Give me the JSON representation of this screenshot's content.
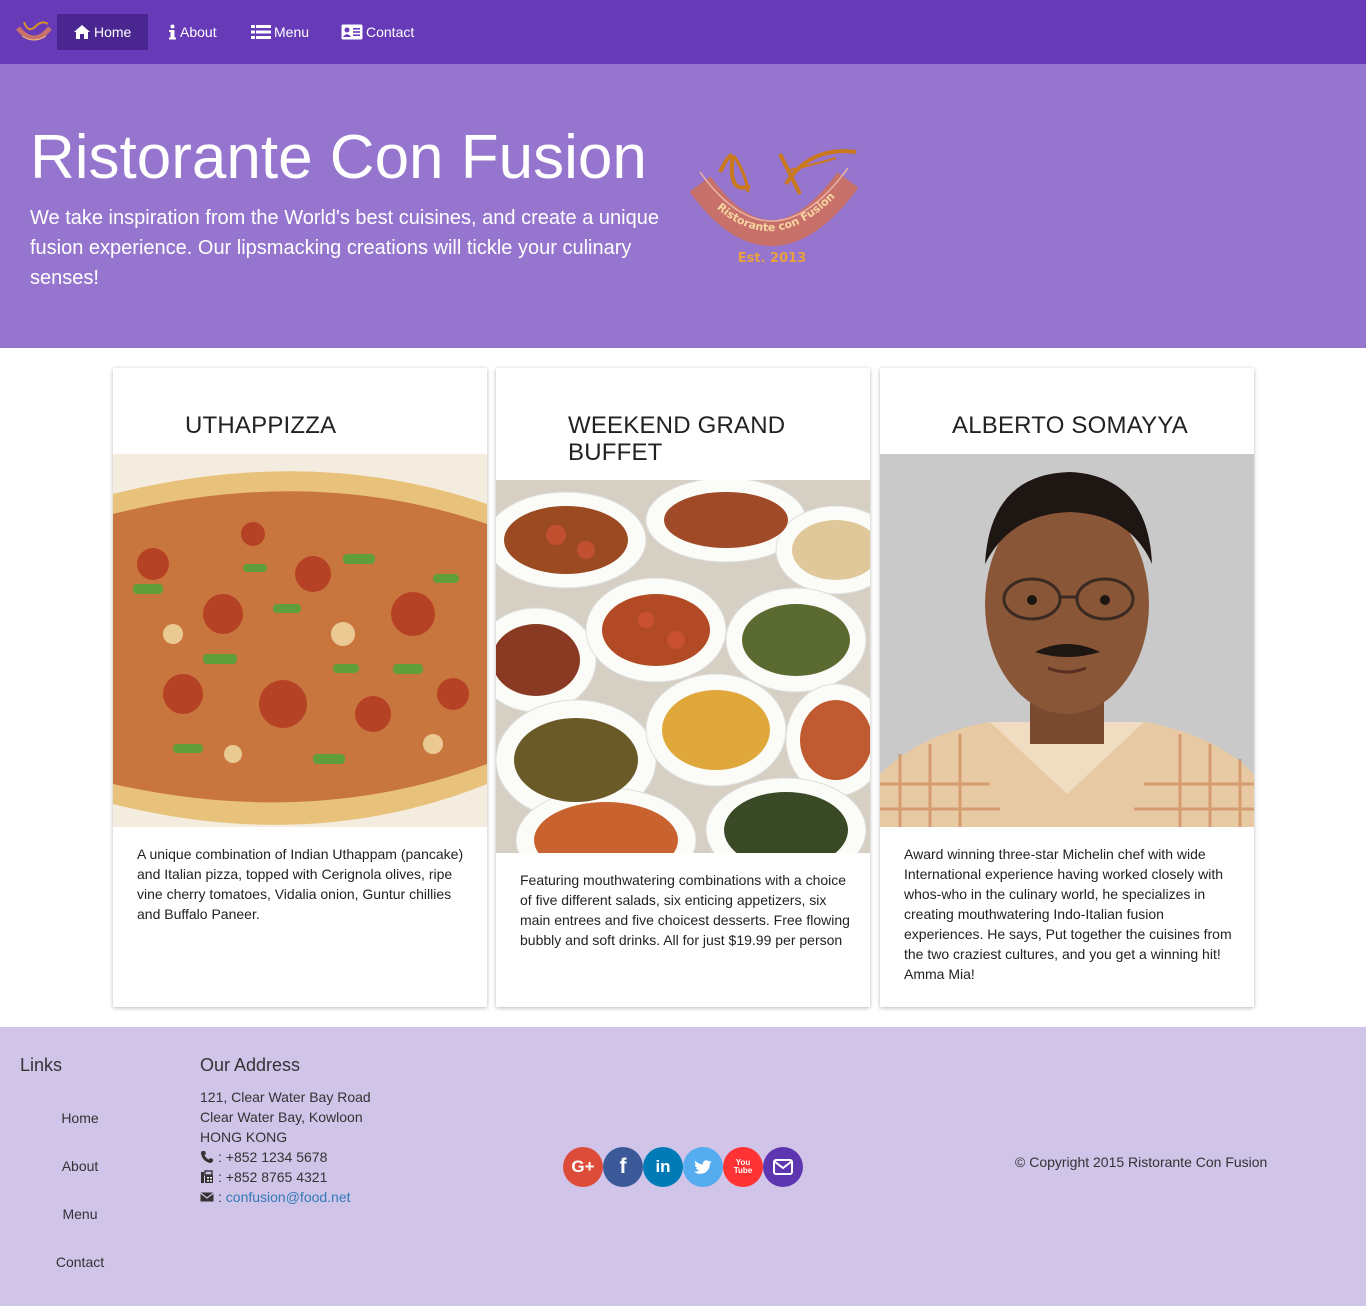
{
  "nav": {
    "items": [
      {
        "label": "Home",
        "icon": "home-icon",
        "active": true
      },
      {
        "label": "About",
        "icon": "info-icon"
      },
      {
        "label": "Menu",
        "icon": "list-icon"
      },
      {
        "label": "Contact",
        "icon": "address-card-icon"
      }
    ],
    "logo_icon": "restaurant-logo"
  },
  "jumbotron": {
    "title": "Ristorante Con Fusion",
    "text": "We take inspiration from the World's best cuisines, and create a unique fusion experience. Our lipsmacking creations will tickle your culinary senses!",
    "logo_ribbon_text": "Ristorante con Fusion",
    "logo_est_text": "Est. 2013"
  },
  "cards": [
    {
      "title": "UTHAPPIZZA",
      "image": "pizza-image",
      "description": "A unique combination of Indian Uthappam (pancake) and Italian pizza, topped with Cerignola olives, ripe vine cherry tomatoes, Vidalia onion, Guntur chillies and Buffalo Paneer."
    },
    {
      "title": "WEEKEND GRAND BUFFET",
      "image": "buffet-image",
      "description": "Featuring mouthwatering combinations with a choice of five different salads, six enticing appetizers, six main entrees and five choicest desserts. Free flowing bubbly and soft drinks. All for just $19.99 per person"
    },
    {
      "title": "ALBERTO SOMAYYA",
      "image": "chef-photo",
      "description": "Award winning three-star Michelin chef with wide International experience having worked closely with whos-who in the culinary world, he specializes in creating mouthwatering Indo-Italian fusion experiences. He says, Put together the cuisines from the two craziest cultures, and you get a winning hit! Amma Mia!"
    }
  ],
  "footer": {
    "links_heading": "Links",
    "links": [
      "Home",
      "About",
      "Menu",
      "Contact"
    ],
    "address_heading": "Our Address",
    "address_lines": [
      "121, Clear Water Bay Road",
      "Clear Water Bay, Kowloon",
      "HONG KONG"
    ],
    "phone": ": +852 1234 5678",
    "fax": ": +852 8765 4321",
    "email_prefix": ": ",
    "email": "confusion@food.net",
    "social": [
      {
        "name": "google-plus-icon",
        "glyph": "G+",
        "color": "#dd4b39"
      },
      {
        "name": "facebook-icon",
        "glyph": "f",
        "color": "#3b5998"
      },
      {
        "name": "linkedin-icon",
        "glyph": "in",
        "color": "#007bb6"
      },
      {
        "name": "twitter-icon",
        "glyph": "🐦",
        "color": "#55acee"
      },
      {
        "name": "youtube-icon",
        "glyph": "You Tube",
        "color": "#ff3333"
      },
      {
        "name": "mail-icon",
        "glyph": "✉",
        "color": "#5e35b1"
      }
    ],
    "copyright": "© Copyright 2015 Ristorante Con Fusion"
  },
  "colors": {
    "navbar": "#673ab7",
    "jumbotron": "#9575cd",
    "footer": "#d1c4e9",
    "nav_active": "#4a2790",
    "link": "#337ab7"
  }
}
